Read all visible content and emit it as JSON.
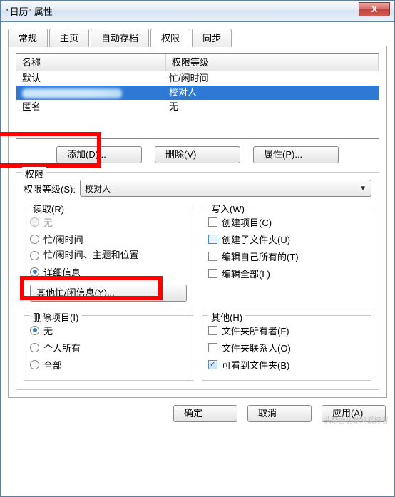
{
  "window": {
    "title": "\"日历\" 属性"
  },
  "tabs": [
    "常规",
    "主页",
    "自动存档",
    "权限",
    "同步"
  ],
  "tabs_active_index": 3,
  "list": {
    "headers": {
      "name": "名称",
      "level": "权限等级"
    },
    "rows": [
      {
        "name": "默认",
        "level": "忙/闲时间",
        "selected": false
      },
      {
        "name": "",
        "level": "校对人",
        "selected": true,
        "blurred": true
      },
      {
        "name": "匿名",
        "level": "无",
        "selected": false
      }
    ]
  },
  "buttons": {
    "add": "添加(D)...",
    "remove": "删除(V)",
    "properties": "属性(P)...",
    "other_fb": "其他忙/闲信息(Y)...",
    "ok": "确定",
    "cancel": "取消",
    "apply": "应用(A)"
  },
  "perm": {
    "legend": "权限",
    "level_label": "权限等级(S):",
    "level_value": "校对人",
    "read": {
      "legend": "读取(R)",
      "options": [
        {
          "label": "无",
          "selected": false,
          "disabled": true
        },
        {
          "label": "忙/闲时间",
          "selected": false,
          "disabled": false
        },
        {
          "label": "忙/闲时间、主题和位置",
          "selected": false,
          "disabled": false,
          "multiline": true
        },
        {
          "label": "详细信息",
          "selected": true,
          "disabled": false
        }
      ]
    },
    "write": {
      "legend": "写入(W)",
      "options": [
        {
          "label": "创建项目(C)",
          "checked": false
        },
        {
          "label": "创建子文件夹(U)",
          "checked": false,
          "hi": true
        },
        {
          "label": "编辑自己所有的(T)",
          "checked": false
        },
        {
          "label": "编辑全部(L)",
          "checked": false
        }
      ]
    },
    "delete": {
      "legend": "删除项目(I)",
      "options": [
        {
          "label": "无",
          "selected": true
        },
        {
          "label": "个人所有",
          "selected": false
        },
        {
          "label": "全部",
          "selected": false
        }
      ]
    },
    "other": {
      "legend": "其他(H)",
      "options": [
        {
          "label": "文件夹所有者(F)",
          "checked": false
        },
        {
          "label": "文件夹联系人(O)",
          "checked": false
        },
        {
          "label": "可看到文件夹(B)",
          "checked": true
        }
      ]
    }
  },
  "watermark": "头条@伪数码爱好者"
}
